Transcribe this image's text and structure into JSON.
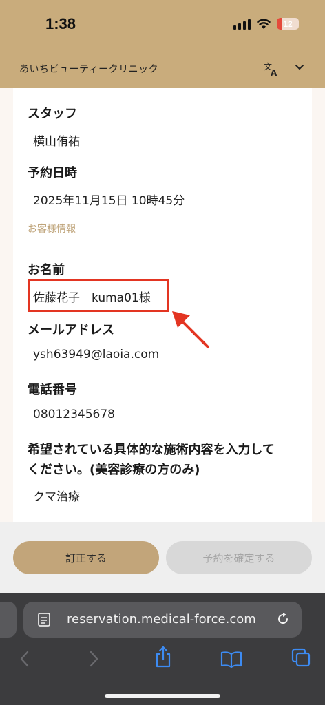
{
  "status_bar": {
    "time": "1:38",
    "battery": "12",
    "battery_level": 0.12
  },
  "header": {
    "site_name": "あいちビューティークリニック"
  },
  "fields": {
    "staff": {
      "label": "スタッフ",
      "value": "横山侑祐"
    },
    "datetime": {
      "label": "予約日時",
      "value": "2025年11月15日 10時45分"
    },
    "customer_section": "お客様情報",
    "name": {
      "label": "お名前",
      "value": "佐藤花子　kuma01様"
    },
    "email": {
      "label": "メールアドレス",
      "value": "ysh63949@laoia.com"
    },
    "phone": {
      "label": "電話番号",
      "value": "08012345678"
    },
    "treatment": {
      "label_line1": "希望されている具体的な施術内容を入力して",
      "label_line2": "ください。(美容診療の方のみ)",
      "value": "クマ治療"
    }
  },
  "actions": {
    "correct_label": "訂正する",
    "confirm_label": "予約を確定する"
  },
  "browser": {
    "url": "reservation.medical-force.com"
  },
  "colors": {
    "accent": "#c2a57a",
    "header_bg": "#c9ac7c",
    "annotation": "#e33522"
  }
}
